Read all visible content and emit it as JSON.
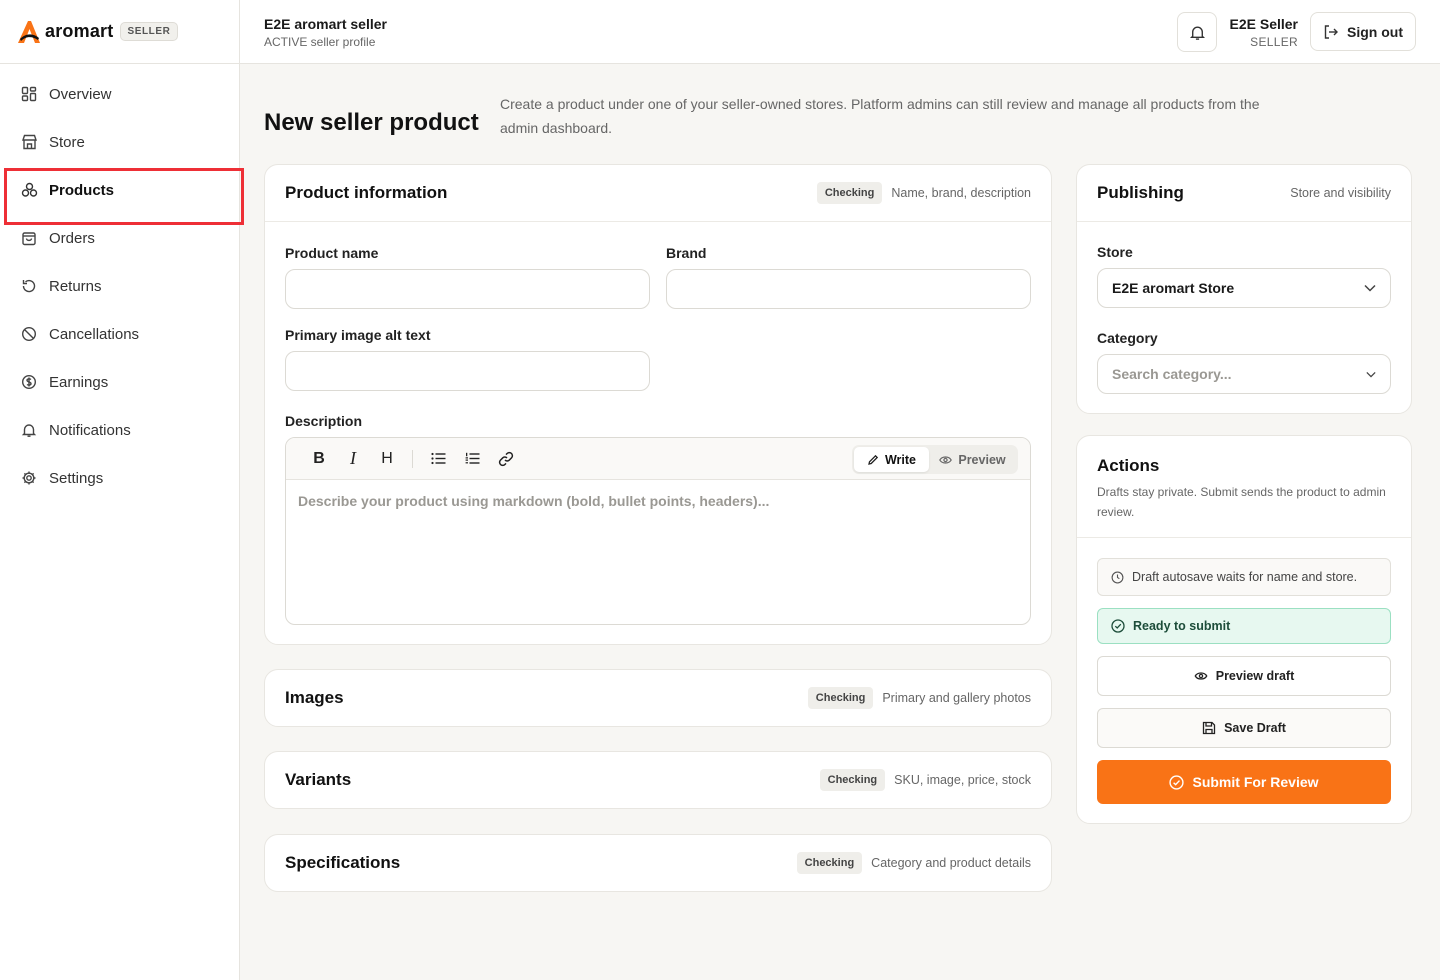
{
  "brand": {
    "name": "aromart",
    "badge": "SELLER"
  },
  "sidebar": {
    "items": [
      {
        "label": "Overview",
        "icon": "grid-icon"
      },
      {
        "label": "Store",
        "icon": "store-icon"
      },
      {
        "label": "Products",
        "icon": "products-icon",
        "active": true
      },
      {
        "label": "Orders",
        "icon": "bag-icon"
      },
      {
        "label": "Returns",
        "icon": "return-icon"
      },
      {
        "label": "Cancellations",
        "icon": "ban-icon"
      },
      {
        "label": "Earnings",
        "icon": "dollar-icon"
      },
      {
        "label": "Notifications",
        "icon": "bell-icon"
      },
      {
        "label": "Settings",
        "icon": "gear-icon"
      }
    ]
  },
  "header": {
    "title": "E2E aromart seller",
    "subtitle": "ACTIVE seller profile",
    "user_name": "E2E Seller",
    "user_role": "SELLER",
    "signout_label": "Sign out"
  },
  "page": {
    "title": "New seller product",
    "description": "Create a product under one of your seller-owned stores. Platform admins can still review and manage all products from the admin dashboard."
  },
  "product_info": {
    "title": "Product information",
    "status": "Checking",
    "hint": "Name, brand, description",
    "product_name_label": "Product name",
    "product_name_value": "",
    "brand_label": "Brand",
    "brand_value": "",
    "alt_text_label": "Primary image alt text",
    "alt_text_value": "",
    "description_label": "Description",
    "editor": {
      "bold": "B",
      "italic": "I",
      "heading": "H",
      "write_label": "Write",
      "preview_label": "Preview",
      "placeholder": "Describe your product using markdown (bold, bullet points, headers)..."
    }
  },
  "sections": [
    {
      "title": "Images",
      "status": "Checking",
      "hint": "Primary and gallery photos"
    },
    {
      "title": "Variants",
      "status": "Checking",
      "hint": "SKU, image, price, stock"
    },
    {
      "title": "Specifications",
      "status": "Checking",
      "hint": "Category and product details"
    }
  ],
  "publishing": {
    "title": "Publishing",
    "hint": "Store and visibility",
    "store_label": "Store",
    "store_value": "E2E aromart Store",
    "category_label": "Category",
    "category_placeholder": "Search category..."
  },
  "actions": {
    "title": "Actions",
    "description": "Drafts stay private. Submit sends the product to admin review.",
    "autosave_note": "Draft autosave waits for name and store.",
    "ready_status": "Ready to submit",
    "preview_label": "Preview draft",
    "save_label": "Save Draft",
    "submit_label": "Submit For Review"
  },
  "colors": {
    "accent": "#f97316",
    "highlight": "#ee2f36",
    "ready_bg": "#e7f8f0",
    "ready_border": "#9be0c2"
  }
}
